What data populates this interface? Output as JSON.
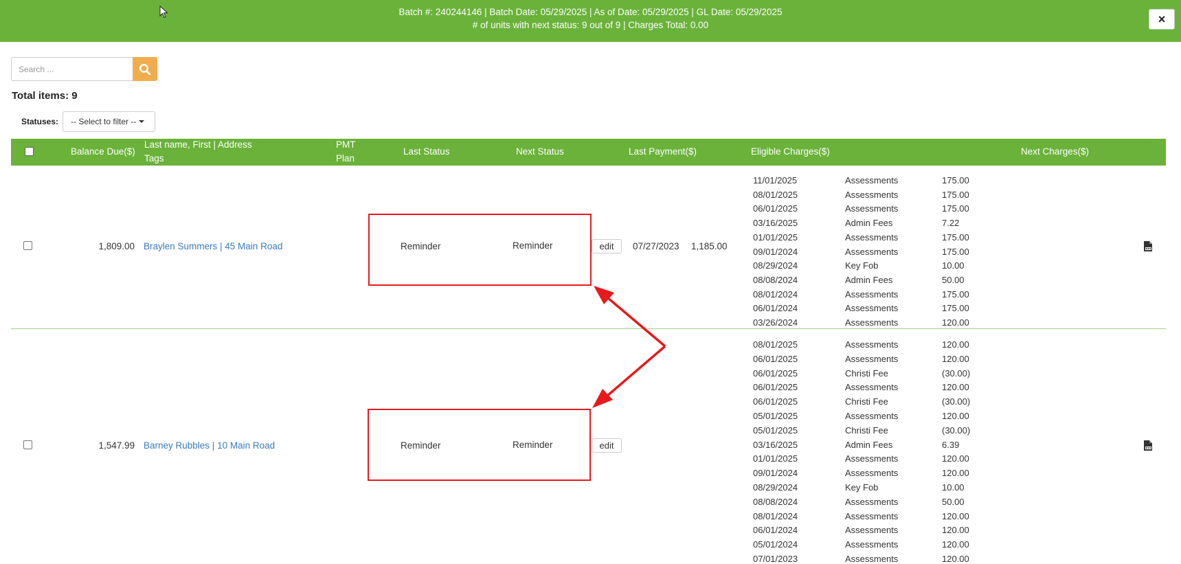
{
  "header": {
    "line1": "Batch #: 240244146  | Batch Date: 05/29/2025  | As of Date: 05/29/2025  | GL Date: 05/29/2025",
    "line2": "# of units with next status: 9 out of 9 | Charges Total: 0.00",
    "close_label": "×",
    "bg_color": "#6ab23a"
  },
  "search": {
    "placeholder": "Search ..."
  },
  "total_items": "Total items: 9",
  "filter": {
    "label": "Statuses:",
    "selected": "-- Select to filter --"
  },
  "table": {
    "columns": {
      "balance": "Balance Due($)",
      "name_line1": "Last name, First | Address",
      "name_line2": "Tags",
      "pmt_line1": "PMT",
      "pmt_line2": "Plan",
      "last_status": "Last Status",
      "next_status": "Next Status",
      "last_payment": "Last Payment($)",
      "eligible": "Eligible Charges($)",
      "next_charges": "Next Charges($)"
    },
    "rows": [
      {
        "balance": "1,809.00",
        "name": "Braylen Summers | 45 Main Road",
        "last_status": "Reminder",
        "next_status": "Reminder",
        "edit_label": "edit",
        "last_payment_date": "07/27/2023",
        "last_payment_amount": "1,185.00",
        "charges": [
          {
            "date": "11/01/2025",
            "desc": "Assessments",
            "amount": "175.00"
          },
          {
            "date": "08/01/2025",
            "desc": "Assessments",
            "amount": "175.00"
          },
          {
            "date": "06/01/2025",
            "desc": "Assessments",
            "amount": "175.00"
          },
          {
            "date": "03/16/2025",
            "desc": "Admin Fees",
            "amount": "7.22"
          },
          {
            "date": "01/01/2025",
            "desc": "Assessments",
            "amount": "175.00"
          },
          {
            "date": "09/01/2024",
            "desc": "Assessments",
            "amount": "175.00"
          },
          {
            "date": "08/29/2024",
            "desc": "Key Fob",
            "amount": "10.00"
          },
          {
            "date": "08/08/2024",
            "desc": "Admin Fees",
            "amount": "50.00"
          },
          {
            "date": "08/01/2024",
            "desc": "Assessments",
            "amount": "175.00"
          },
          {
            "date": "06/01/2024",
            "desc": "Assessments",
            "amount": "175.00"
          },
          {
            "date": "03/26/2024",
            "desc": "Assessments",
            "amount": "120.00"
          }
        ]
      },
      {
        "balance": "1,547.99",
        "name": "Barney Rubbles | 10 Main Road",
        "last_status": "Reminder",
        "next_status": "Reminder",
        "edit_label": "edit",
        "charges": [
          {
            "date": "08/01/2025",
            "desc": "Assessments",
            "amount": "120.00"
          },
          {
            "date": "06/01/2025",
            "desc": "Assessments",
            "amount": "120.00"
          },
          {
            "date": "06/01/2025",
            "desc": "Christi Fee",
            "amount": "(30.00)"
          },
          {
            "date": "06/01/2025",
            "desc": "Assessments",
            "amount": "120.00"
          },
          {
            "date": "06/01/2025",
            "desc": "Christi Fee",
            "amount": "(30.00)"
          },
          {
            "date": "05/01/2025",
            "desc": "Assessments",
            "amount": "120.00"
          },
          {
            "date": "05/01/2025",
            "desc": "Christi Fee",
            "amount": "(30.00)"
          },
          {
            "date": "03/16/2025",
            "desc": "Admin Fees",
            "amount": "6.39"
          },
          {
            "date": "01/01/2025",
            "desc": "Assessments",
            "amount": "120.00"
          },
          {
            "date": "09/01/2024",
            "desc": "Assessments",
            "amount": "120.00"
          },
          {
            "date": "08/29/2024",
            "desc": "Key Fob",
            "amount": "10.00"
          },
          {
            "date": "08/08/2024",
            "desc": "Assessments",
            "amount": "50.00"
          },
          {
            "date": "08/01/2024",
            "desc": "Assessments",
            "amount": "120.00"
          },
          {
            "date": "06/01/2024",
            "desc": "Assessments",
            "amount": "120.00"
          },
          {
            "date": "05/01/2024",
            "desc": "Assessments",
            "amount": "120.00"
          },
          {
            "date": "07/01/2023",
            "desc": "Assessments",
            "amount": "120.00"
          }
        ]
      }
    ]
  },
  "annotation": {
    "color": "#e8191c"
  }
}
